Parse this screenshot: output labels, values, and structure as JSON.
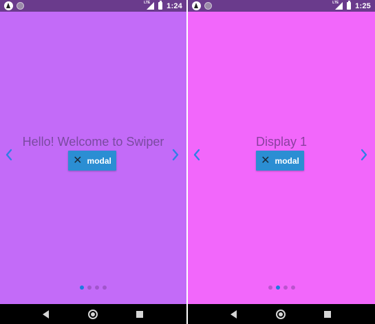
{
  "screens": [
    {
      "status_bar": {
        "time": "1:24",
        "network": "LTE"
      },
      "slide_text": "Hello! Welcome to Swiper",
      "modal_button": {
        "label": "modal",
        "icon": "close-icon"
      },
      "arrows": {
        "prev": "chevron-left-icon",
        "next": "chevron-right-icon"
      },
      "background": "#c36bf8",
      "pagination": {
        "count": 4,
        "active_index": 0
      }
    },
    {
      "status_bar": {
        "time": "1:25",
        "network": "LTE"
      },
      "slide_text": "Display 1",
      "modal_button": {
        "label": "modal",
        "icon": "close-icon"
      },
      "arrows": {
        "prev": "chevron-left-icon",
        "next": "chevron-right-icon"
      },
      "background": "#f267fb",
      "pagination": {
        "count": 4,
        "active_index": 1
      }
    }
  ],
  "colors": {
    "status_bar": "#6a3b8c",
    "button": "#2b8ed3",
    "arrow": "#2f7fe6",
    "active_dot": "#1d7be0",
    "nav_bar": "#000000"
  }
}
